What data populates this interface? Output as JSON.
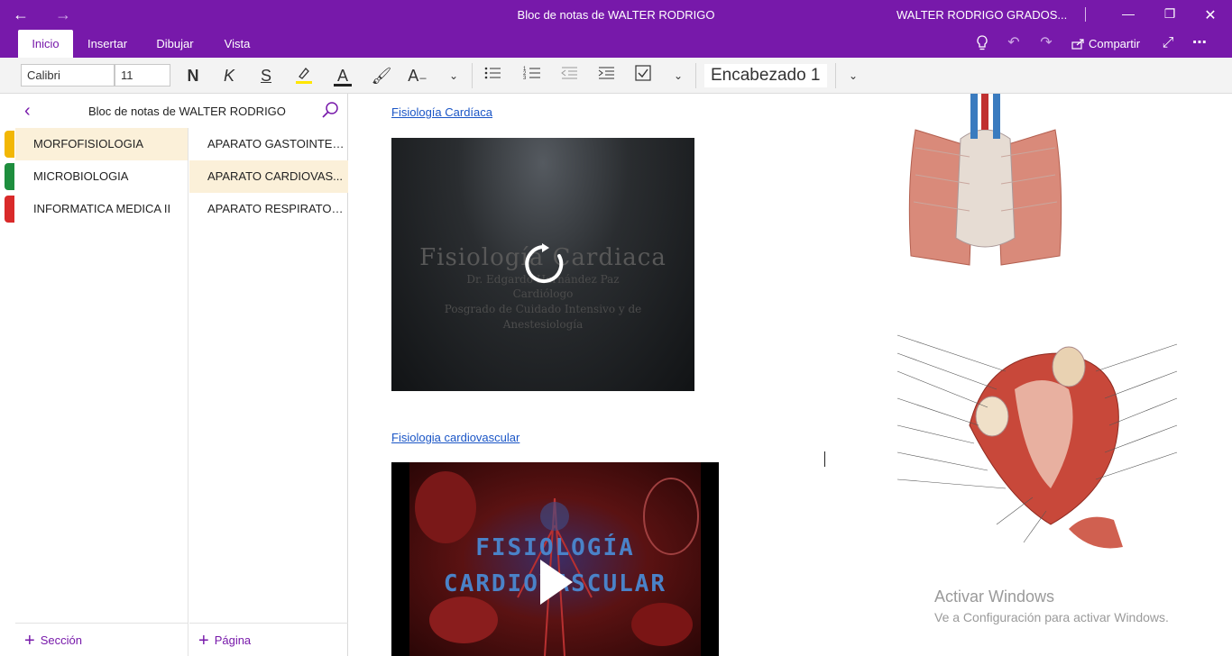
{
  "titlebar": {
    "back_icon": "arrow-left-icon",
    "forward_icon": "arrow-right-icon",
    "title": "Bloc de notas de WALTER RODRIGO",
    "user": "WALTER RODRIGO GRADOS...",
    "accent": "#7719aa"
  },
  "ribbon": {
    "tabs": [
      {
        "label": "Inicio",
        "active": true
      },
      {
        "label": "Insertar",
        "active": false
      },
      {
        "label": "Dibujar",
        "active": false
      },
      {
        "label": "Vista",
        "active": false
      }
    ],
    "share_label": "Compartir"
  },
  "toolbar": {
    "font_name": "Calibri",
    "font_size": "11",
    "bold_glyph": "N",
    "italic_glyph": "K",
    "strike_glyph": "S",
    "font_color_glyph": "A",
    "style": "Encabezado 1"
  },
  "navigation": {
    "notebook_name": "Bloc de notas de WALTER RODRIGO",
    "sections": [
      {
        "label": "MORFOFISIOLOGIA",
        "color": "#f2b705",
        "selected": true
      },
      {
        "label": "MICROBIOLOGIA",
        "color": "#1e8e3e",
        "selected": false
      },
      {
        "label": "INFORMATICA MEDICA II",
        "color": "#d92a2a",
        "selected": false
      }
    ],
    "pages": [
      {
        "label": "APARATO GASTOINTES...",
        "selected": false
      },
      {
        "label": "APARATO CARDIOVAS...",
        "selected": true
      },
      {
        "label": "APARATO RESPIRATORIO",
        "selected": false
      }
    ],
    "add_section_label": "Sección",
    "add_page_label": "Página"
  },
  "canvas": {
    "link1": "Fisiología Cardíaca",
    "video1": {
      "title": "Fisiología Cardiaca",
      "author": "Dr. Edgardo Hernández Paz",
      "role": "Cardiólogo",
      "program_line1": "Posgrado de Cuidado Intensivo y de",
      "program_line2": "Anestesiología"
    },
    "link2": "Fisiologia cardiovascular",
    "video2": {
      "title_line1": "FISIOLOGÍA",
      "title_line2": "CARDIOVASCULAR"
    }
  },
  "watermark": {
    "line1": "Activar Windows",
    "line2": "Ve a Configuración para activar Windows."
  }
}
